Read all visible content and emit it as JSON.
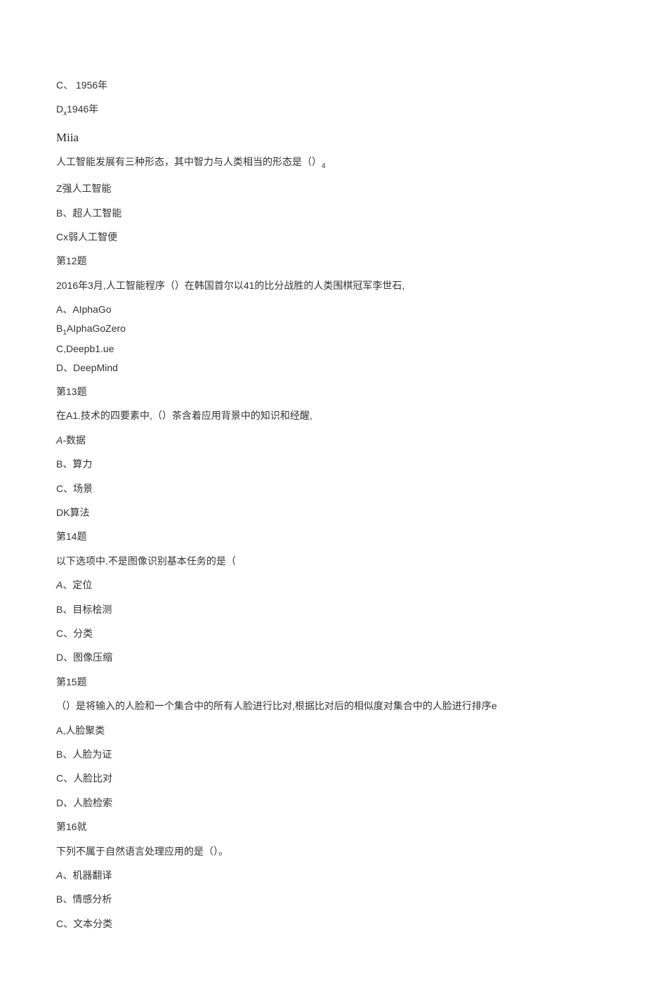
{
  "lines": {
    "l01": "C、 1956年",
    "l02a": "D",
    "l02b": "x",
    "l02c": "1946年",
    "l03": "Miia",
    "l04": "人工智能发展有三种形态，其中智力与人类相当的形态是（）",
    "l04sub": "4",
    "l05": "Z强人工智能",
    "l06": "B、超人工智能",
    "l07": "Cx弱人工智便",
    "l08": "第12题",
    "l09": "2016年3月,人工智能程序（）在韩国首尔以41的比分战胜的人类围棋冠军李世石,",
    "l10": "A、AIphaGo",
    "l11a": "B",
    "l11b": "1",
    "l11c": "AIphaGoZero",
    "l12": "C,Deepb1.ue",
    "l13": "D、DeepMind",
    "l14": "第13题",
    "l15": "在A1.技术的四要素中,（）茶含着应用背景中的知识和经醒,",
    "l16a": "A-",
    "l16b": "数据",
    "l17": "B、算力",
    "l18": "C、场景",
    "l19": "DK算法",
    "l20": "第14题",
    "l21": "以下选项中.不是图像识别基本任务的是（",
    "l22a": "A",
    "l22b": "、定位",
    "l23": "B、目标桧测",
    "l24": "C、分类",
    "l25": "D、图像压缩",
    "l26": "第15题",
    "l27": "（）是将输入的人脸和一个集合中的所有人脸进行比对,根据比对后的相似度对集合中的人脸进行排序e",
    "l28": "A,人脸聚类",
    "l29": "B、人脸为证",
    "l30": "C、人脸比对",
    "l31": "D、人脸检索",
    "l32": "第16就",
    "l33": "下列不属于自然语言处理应用的是（）。",
    "l34a": "A",
    "l34b": "、机器翻译",
    "l35": "B、情感分析",
    "l36": "C、文本分类"
  }
}
